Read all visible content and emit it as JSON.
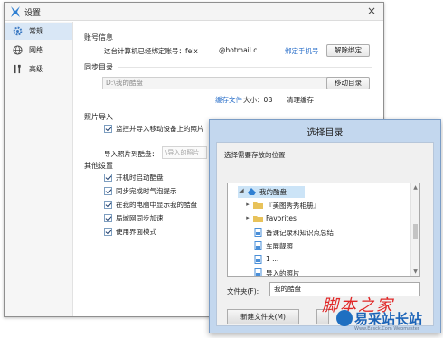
{
  "settings_window": {
    "title": "设置",
    "close_label": "×",
    "sidebar": [
      {
        "label": "常规",
        "icon": "gear-icon",
        "active": true
      },
      {
        "label": "网络",
        "icon": "globe-icon",
        "active": false
      },
      {
        "label": "高级",
        "icon": "tools-icon",
        "active": false
      }
    ],
    "account": {
      "heading": "账号信息",
      "bound_text": "这台计算机已经绑定账号：feix",
      "account_tail": "@hotmail.c...",
      "bind_phone_link": "绑定手机号",
      "unbind_button": "解除绑定"
    },
    "sync_dir": {
      "heading": "同步目录",
      "path_value": "D:\\我的酷盘",
      "move_button": "移动目录",
      "cache_link": "缓存文件",
      "cache_size_text": "大小：0B",
      "clear_cache": "清理缓存"
    },
    "photo_import": {
      "heading": "照片导入",
      "auto_import_label": "监控并导入移动设备上的照片",
      "import_to_label": "导入照片到酷盘：",
      "import_to_value": "\\导入的照片"
    },
    "other": {
      "heading": "其他设置",
      "options": [
        {
          "label": "开机时启动酷盘",
          "checked": true
        },
        {
          "label": "同步完成时气泡提示",
          "checked": true
        },
        {
          "label": "在我的电脑中显示我的酷盘",
          "checked": true
        },
        {
          "label": "局域网同步加速",
          "checked": true
        },
        {
          "label": "使用界面模式",
          "checked": true
        }
      ]
    }
  },
  "dialog": {
    "title": "选择目录",
    "prompt": "选择需要存放的位置",
    "tree": [
      {
        "label": "我的酷盘",
        "icon": "cloud-folder-icon",
        "arrow": "◢",
        "selected": true
      },
      {
        "label": "『美图秀秀相册』",
        "icon": "folder-icon",
        "arrow": "▸",
        "selected": false
      },
      {
        "label": "Favorites",
        "icon": "folder-icon",
        "arrow": "▸",
        "selected": false
      },
      {
        "label": "备课记录和知识点总结",
        "icon": "file-icon",
        "arrow": "",
        "selected": false
      },
      {
        "label": "车展靓照",
        "icon": "file-icon",
        "arrow": "",
        "selected": false
      },
      {
        "label": "1 ...",
        "icon": "file-icon",
        "arrow": "",
        "selected": false
      },
      {
        "label": "导入的照片",
        "icon": "file-icon",
        "arrow": "",
        "selected": false
      }
    ],
    "folder_label": "文件夹(F):",
    "folder_value": "我的酷盘",
    "new_folder_button": "新建文件夹(M)"
  },
  "watermark": {
    "red_text": "脚本之家",
    "blue_text": "易采站长站",
    "sub_text": "Www.Easck.Com Webmaster"
  },
  "colors": {
    "accent": "#2a6fc9",
    "dialog_frame": "#c3d7ee",
    "selected": "#d9e7f6"
  }
}
